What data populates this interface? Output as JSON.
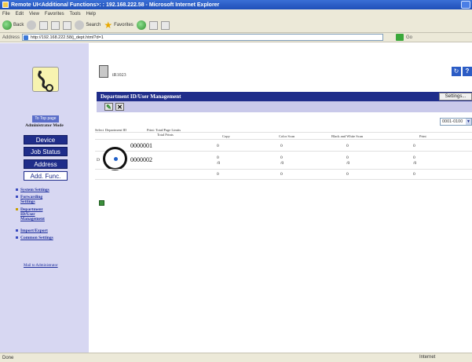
{
  "window": {
    "title": "Remote UI<Additional Functions>: : 192.168.222.58 - Microsoft Internet Explorer"
  },
  "menu": [
    "File",
    "Edit",
    "View",
    "Favorites",
    "Tools",
    "Help"
  ],
  "toolbar": {
    "back_label": "Back",
    "search_label": "Search",
    "favorites_label": "Favorites"
  },
  "address": {
    "label": "Address",
    "url": "http://192.168.222.58/j_dept.html?d=1",
    "go_label": "Go"
  },
  "sidebar": {
    "top_page_label": "To Top page",
    "mode_label": "Administrator Mode",
    "buttons": [
      {
        "label": "Device"
      },
      {
        "label": "Job Status"
      },
      {
        "label": "Address"
      },
      {
        "label": "Add. Func."
      }
    ],
    "links": [
      {
        "label": "System Settings"
      },
      {
        "label": "Forwarding Settings"
      },
      {
        "label": "Department ID/User Management"
      },
      {
        "label": "Import/Export"
      },
      {
        "label": "Common Settings"
      }
    ],
    "mail_label": "Mail to Administrator"
  },
  "main": {
    "device_name": "iR1023",
    "section_title": "Department ID/User Management",
    "settings_label": "Settings...",
    "range_value": "0001-0100",
    "table": {
      "header_select": "Select",
      "header_dept": "Department ID",
      "header_group": "Print: Total/Page Limits",
      "columns": [
        "Total Prints",
        "Copy",
        "Color Scan",
        "Black and White Scan",
        "Print"
      ],
      "rows": [
        {
          "dept": "0000001",
          "values": [
            "0",
            "0",
            "0",
            "0"
          ]
        },
        {
          "dept": "0000002",
          "values": [
            "0",
            "0",
            "0",
            "0"
          ],
          "limits": [
            "/0",
            "/0",
            "/0",
            "/0"
          ]
        },
        {
          "dept": "",
          "values": [
            "0",
            "0",
            "0",
            "0"
          ]
        }
      ]
    }
  },
  "status": {
    "left": "Done",
    "zone": "Internet"
  }
}
